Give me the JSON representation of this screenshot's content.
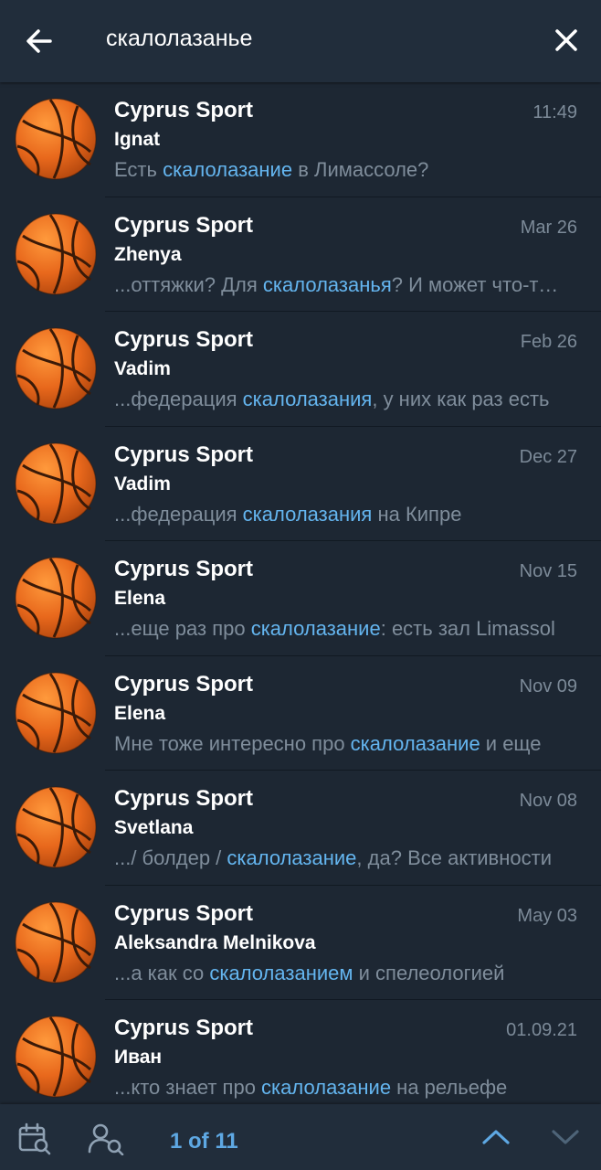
{
  "search": {
    "query": "скалолазанье"
  },
  "results": [
    {
      "title": "Cyprus Sport",
      "date": "11:49",
      "sender": "Ignat",
      "pre": "Есть ",
      "match": "скалолазание",
      "post": " в Лимассоле?"
    },
    {
      "title": "Cyprus Sport",
      "date": "Mar 26",
      "sender": "Zhenya",
      "pre": "...оттяжки? Для ",
      "match": "скалолазанья",
      "post": "? И может что-то еще"
    },
    {
      "title": "Cyprus Sport",
      "date": "Feb 26",
      "sender": "Vadim",
      "pre": "...федерация ",
      "match": "скалолазания",
      "post": ", у них как раз есть"
    },
    {
      "title": "Cyprus Sport",
      "date": "Dec 27",
      "sender": "Vadim",
      "pre": "...федерация ",
      "match": "скалолазания",
      "post": " на Кипре"
    },
    {
      "title": "Cyprus Sport",
      "date": "Nov 15",
      "sender": "Elena",
      "pre": "...еще раз про ",
      "match": "скалолазание",
      "post": ": есть зал Limassol"
    },
    {
      "title": "Cyprus Sport",
      "date": "Nov 09",
      "sender": "Elena",
      "pre": "Мне тоже интересно про ",
      "match": "скалолазание",
      "post": " и еще"
    },
    {
      "title": "Cyprus Sport",
      "date": "Nov 08",
      "sender": "Svetlana",
      "pre": ".../ болдер / ",
      "match": "скалолазание",
      "post": ", да? Все активности"
    },
    {
      "title": "Cyprus Sport",
      "date": "May 03",
      "sender": "Aleksandra Melnikova",
      "pre": "...а как со ",
      "match": "скалолазанием",
      "post": " и спелеологией"
    },
    {
      "title": "Cyprus Sport",
      "date": "01.09.21",
      "sender": "Иван",
      "pre": "...кто знает про ",
      "match": "скалолазание",
      "post": " на рельефе"
    }
  ],
  "bottom": {
    "counter": "1 of 11"
  },
  "icons": {
    "back": "arrow-left-icon",
    "close": "close-icon",
    "calendar": "calendar-search-icon",
    "user": "user-search-icon",
    "up": "chevron-up-icon",
    "down": "chevron-down-icon",
    "avatar": "basketball-icon"
  },
  "colors": {
    "highlight": "#64b5ef",
    "counter": "#5ea8e3",
    "background": "#1d2733"
  }
}
